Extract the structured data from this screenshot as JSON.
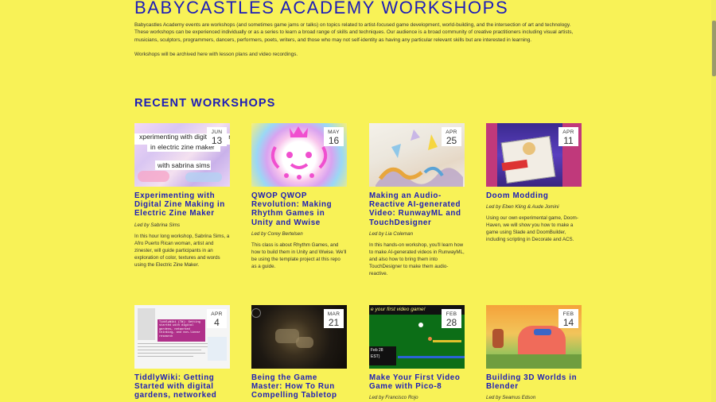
{
  "site": {
    "title": "BABYCASTLES ACADEMY WORKSHOPS",
    "intro": "Babycastles Academy events are workshops (and sometimes game jams or talks) on topics related to artist-focused game development, world-building, and the intersection of art and technology. These workshops can be experienced individually or as a series to learn a broad range of skills and techniques. Our audience is a broad community of creative practitioners including visual artists, musicians, sculptors, programmers, dancers, performers, poets, writers, and those who may not self-identity as having any particular relevant skills but are interested in learning.",
    "archive_note": "Workshops will be archived here with lesson plans and video recordings."
  },
  "section": {
    "heading": "RECENT WORKSHOPS"
  },
  "workshops": [
    {
      "month": "JUN",
      "day": "13",
      "title": "Experimenting with Digital Zine Making in Electric Zine Maker",
      "led_by": "Led by Sabrina Sims",
      "description": "In this hour long workshop, Sabrina Sims, a Afro Puerto Rican woman, artist and zinester, will guide participants in an exploration of color, textures and words using the Electric Zine Maker.",
      "thumb_text_1": "xperimenting with digital zine mak",
      "thumb_text_2": "in electric zine maker",
      "thumb_text_3": "with sabrina sims"
    },
    {
      "month": "MAY",
      "day": "16",
      "title": "QWOP QWOP Revolution: Making Rhythm Games in Unity and Wwise",
      "led_by": "Led by Corey Bertelsen",
      "description": "This class is about Rhythm Games, and how to build them in Unity and Wwise. We'll be using the template project at this repo as a guide."
    },
    {
      "month": "APR",
      "day": "25",
      "title": "Making an Audio-Reactive AI-generated Video: RunwayML and TouchDesigner",
      "led_by": "Led by Lia Coleman",
      "description": "In this hands-on workshop, you'll learn how to make AI-generated videos in RunwayML, and also how to bring them into TouchDesigner to make them audio-reactive."
    },
    {
      "month": "APR",
      "day": "11",
      "title": "Doom Modding",
      "led_by": "Led by Eben Kling & Aude Jomini",
      "description": "Using our own experimental game, Doom-Haven, we will show you how to make a game using Slade and DoomBuilder, including scripting in Decorate and ACS."
    },
    {
      "month": "APR",
      "day": "4",
      "title": "TiddlyWiki: Getting Started with digital gardens, networked",
      "thumb_text_1": "TiddlyWiki (TW): Getting started with digital gardens, networked thinking, and non-linear research"
    },
    {
      "month": "MAR",
      "day": "21",
      "title": "Being the Game Master: How To Run Compelling Tabletop"
    },
    {
      "month": "FEB",
      "day": "28",
      "title": "Make Your First Video Game with Pico-8",
      "led_by": "Led by Francisco Rojo",
      "thumb_text_1": "e your first video game!",
      "thumb_text_2": "Feb 28",
      "thumb_text_3": "EST)"
    },
    {
      "month": "FEB",
      "day": "14",
      "title": "Building 3D Worlds in Blender",
      "led_by": "Led by Seamus Edson"
    }
  ]
}
